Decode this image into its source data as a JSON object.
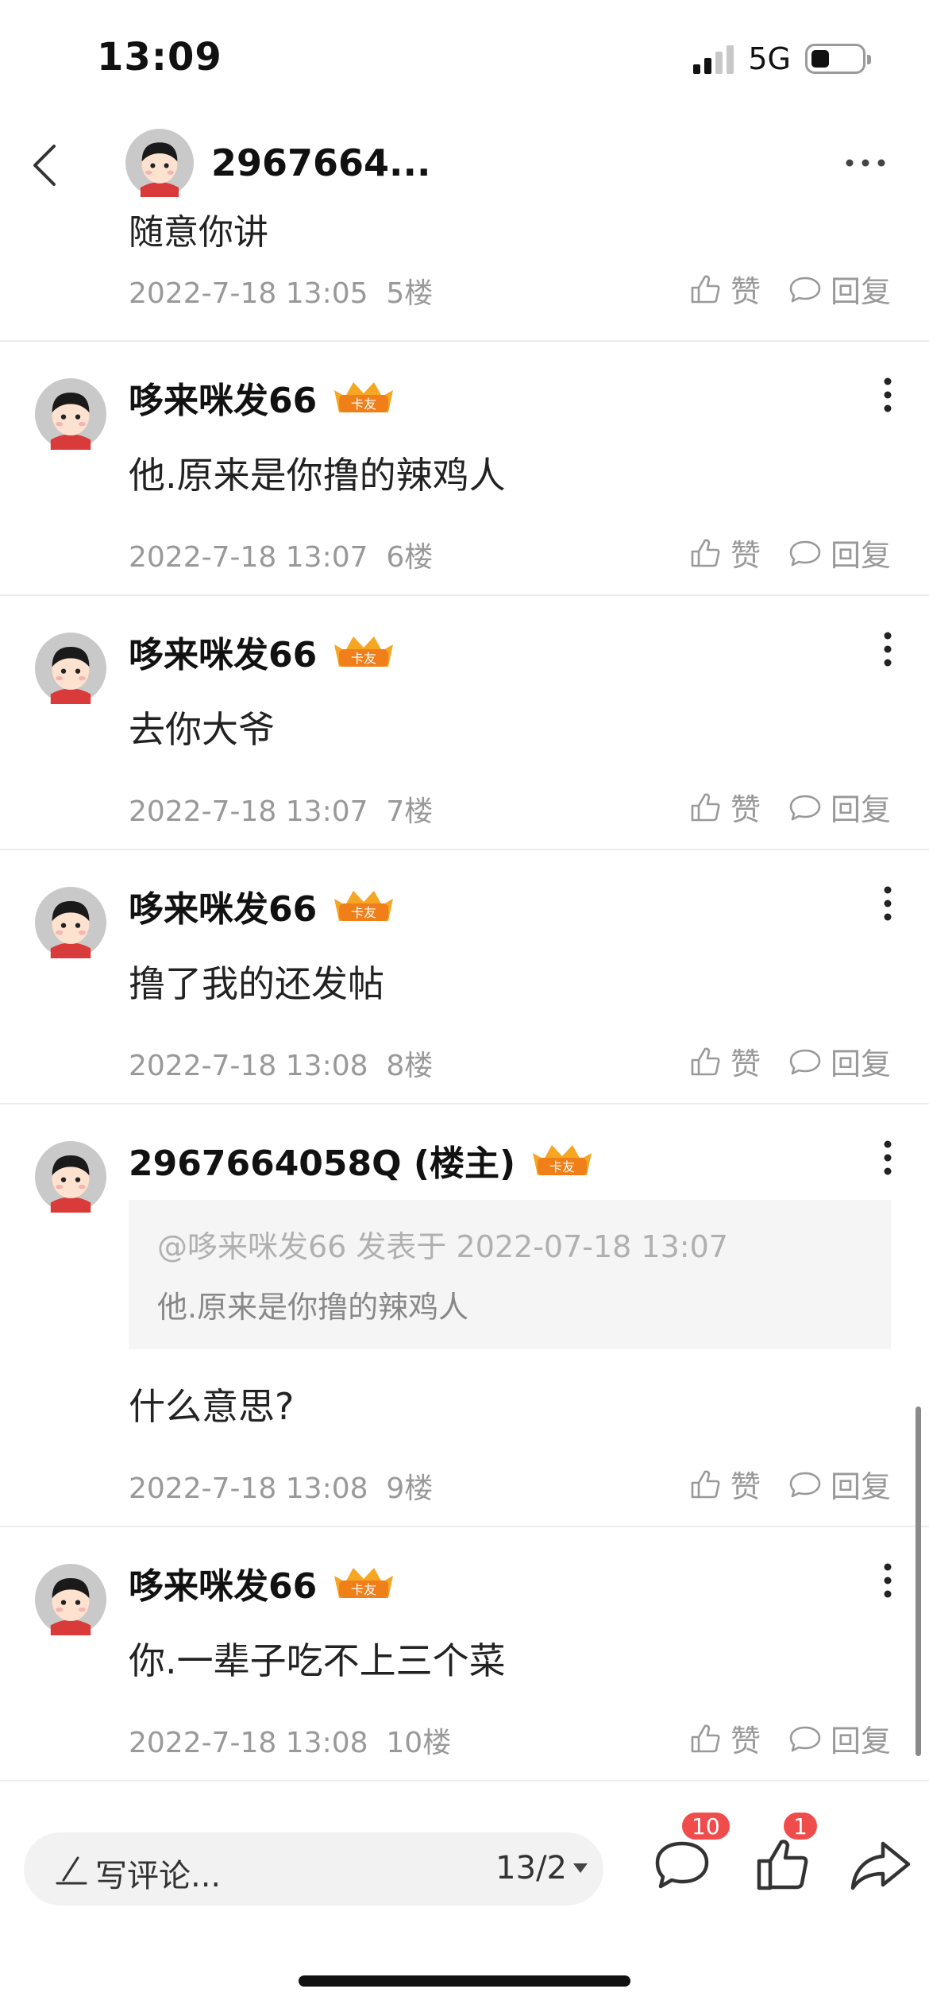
{
  "status": {
    "time": "13:09",
    "network": "5G"
  },
  "nav": {
    "title": "2967664..."
  },
  "partial_post": {
    "text": "随意你讲",
    "date": "2022-7-18 13:05",
    "floor": "5楼"
  },
  "actions": {
    "like": "赞",
    "reply": "回复"
  },
  "badge_text": "卡友",
  "posts": [
    {
      "user": "哆来咪发66",
      "text": "他.原来是你撸的辣鸡人",
      "date": "2022-7-18 13:07",
      "floor": "6楼"
    },
    {
      "user": "哆来咪发66",
      "text": "去你大爷",
      "date": "2022-7-18 13:07",
      "floor": "7楼"
    },
    {
      "user": "哆来咪发66",
      "text": "撸了我的还发帖",
      "date": "2022-7-18 13:08",
      "floor": "8楼"
    },
    {
      "user": "2967664058Q (楼主)",
      "quote_head": "@哆来咪发66 发表于 2022-07-18 13:07",
      "quote_text": "他.原来是你撸的辣鸡人",
      "text": "什么意思?",
      "date": "2022-7-18 13:08",
      "floor": "9楼"
    },
    {
      "user": "哆来咪发66",
      "text": "你.一辈子吃不上三个菜",
      "date": "2022-7-18 13:08",
      "floor": "10楼"
    }
  ],
  "bottom": {
    "placeholder": "写评论...",
    "page": "13/2",
    "comment_count": "10",
    "like_count": "1"
  },
  "colors": {
    "badge": "#f5a623",
    "count_badge": "#f04c4c",
    "meta_text": "#999999"
  }
}
